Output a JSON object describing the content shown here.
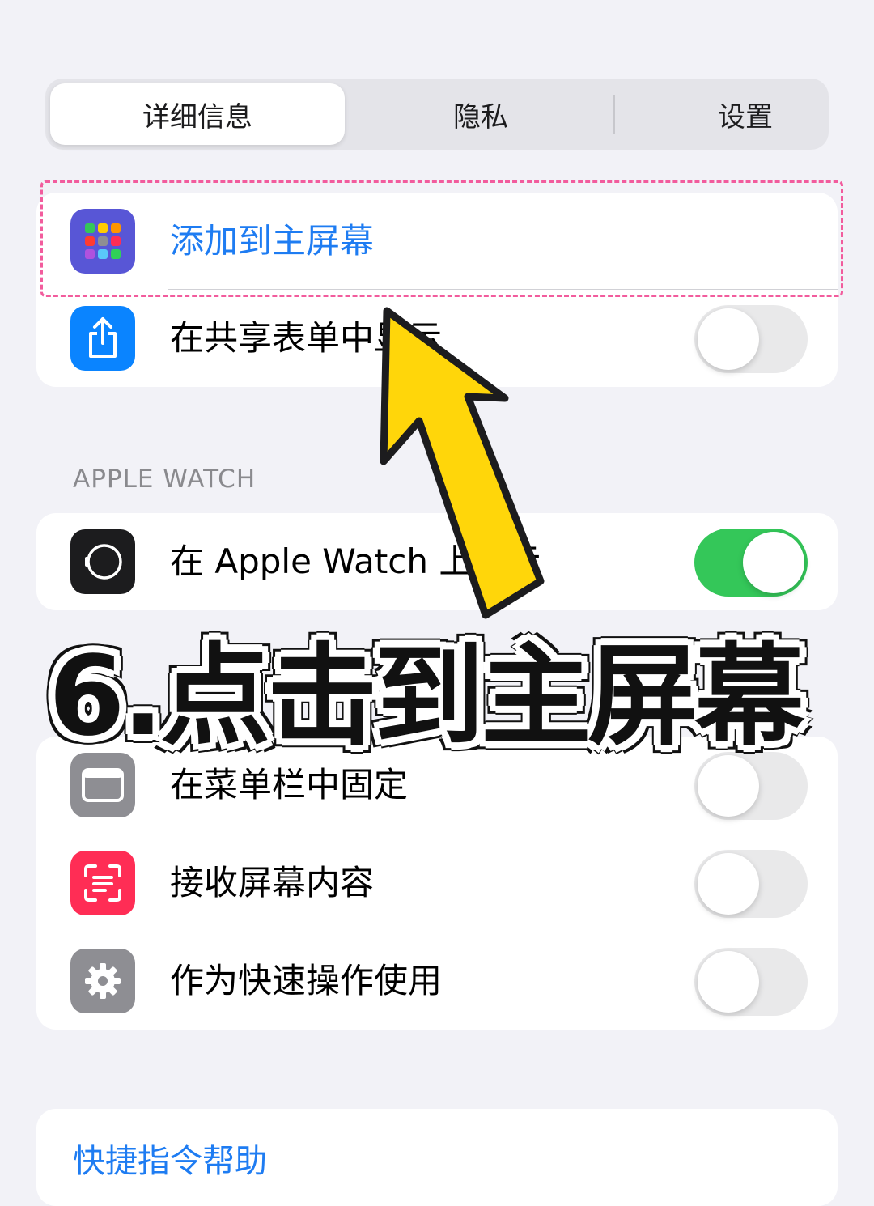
{
  "tabs": [
    {
      "label": "详细信息",
      "selected": true
    },
    {
      "label": "隐私",
      "selected": false
    },
    {
      "label": "设置",
      "selected": false
    }
  ],
  "section_top": {
    "rows": [
      {
        "label": "添加到主屏幕",
        "icon": "app-grid-icon",
        "icon_color": "#5856D6"
      },
      {
        "label": "在共享表单中显示",
        "icon": "share-icon",
        "icon_color": "#0A84FF",
        "toggle": false
      }
    ]
  },
  "apple_watch": {
    "header": "APPLE WATCH",
    "row": {
      "label": "在 Apple Watch 上显示",
      "icon": "watch-icon",
      "toggle": true
    }
  },
  "section_more": {
    "rows": [
      {
        "label": "在菜单栏中固定",
        "icon": "menubar-icon",
        "icon_color": "#8E8E93",
        "toggle": false
      },
      {
        "label": "接收屏幕内容",
        "icon": "screen-scan-icon",
        "icon_color": "#FF2D55",
        "toggle": false
      },
      {
        "label": "作为快速操作使用",
        "icon": "gear-icon",
        "icon_color": "#8E8E93",
        "toggle": false
      }
    ]
  },
  "help_link": "快捷指令帮助",
  "overlay": {
    "caption": "6.点击到主屏幕",
    "arrow_color": "#FFD60A"
  }
}
